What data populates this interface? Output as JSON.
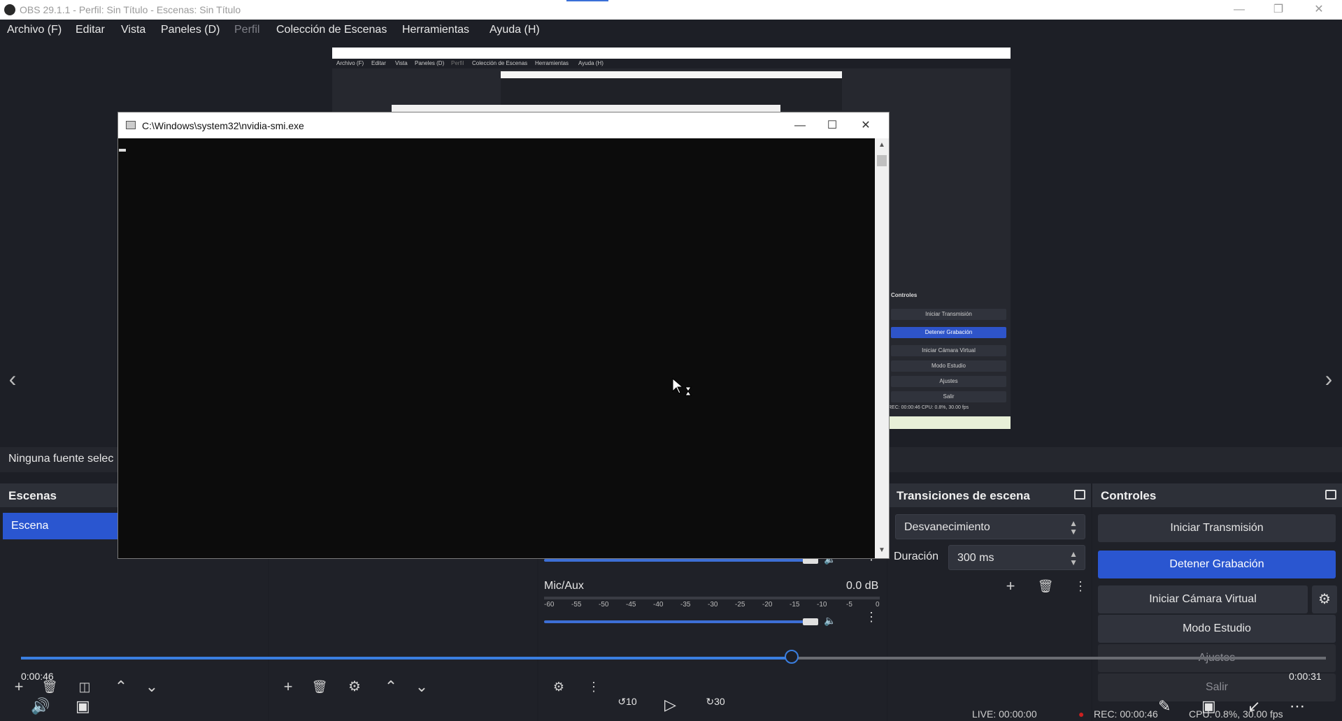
{
  "titlebar": {
    "title": "OBS 29.1.1 - Perfil: Sin Título - Escenas: Sin Título"
  },
  "menu": [
    {
      "label": "Archivo (F)"
    },
    {
      "label": "Editar"
    },
    {
      "label": "Vista"
    },
    {
      "label": "Paneles (D)"
    },
    {
      "label": "Perfil",
      "dim": true
    },
    {
      "label": "Colección de Escenas"
    },
    {
      "label": "Herramientas"
    },
    {
      "label": "Ayuda (H)"
    }
  ],
  "nested": {
    "menu": [
      "Archivo (F)",
      "Editar",
      "Vista",
      "Paneles (D)",
      "Perfil",
      "Colección de Escenas",
      "Herramientas",
      "Ayuda (H)"
    ],
    "controls_title": "Controles",
    "buttons": [
      "Iniciar Transmisión",
      "Detener Grabación",
      "Iniciar Cámara Virtual",
      "Modo Estudio",
      "Ajustes",
      "Salir"
    ],
    "cpu": "REC: 00:00:46   CPU: 0.8%, 30.00 fps"
  },
  "nosource": {
    "text": "Ninguna fuente selec"
  },
  "scenes": {
    "title": "Escenas",
    "items": [
      "Escena"
    ]
  },
  "transitions": {
    "title": "Transiciones de escena",
    "selected": "Desvanecimiento",
    "duration_label": "Duración",
    "duration_value": "300 ms"
  },
  "controls": {
    "title": "Controles",
    "start_stream": "Iniciar Transmisión",
    "stop_record": "Detener Grabación",
    "virtual_cam": "Iniciar Cámara Virtual",
    "studio_mode": "Modo Estudio",
    "settings": "Ajustes",
    "exit": "Salir"
  },
  "mixer": {
    "channel": "Mic/Aux",
    "level": "0.0 dB",
    "scale": [
      "-60",
      "-55",
      "-50",
      "-45",
      "-40",
      "-35",
      "-30",
      "-25",
      "-20",
      "-15",
      "-10",
      "-5",
      "0"
    ]
  },
  "cmd": {
    "title": "C:\\Windows\\system32\\nvidia-smi.exe"
  },
  "player": {
    "elapsed": "0:00:46",
    "remaining": "0:00:31",
    "progress": 0.59,
    "rewind": "10",
    "forward": "30"
  },
  "status": {
    "live": "LIVE: 00:00:00",
    "rec": "REC: 00:00:46",
    "cpu": "CPU: 0.8%, 30.00 fps"
  },
  "colors": {
    "accent": "#2a56d0",
    "rec": "#cc2020",
    "timeline": "#3a7ee0"
  }
}
